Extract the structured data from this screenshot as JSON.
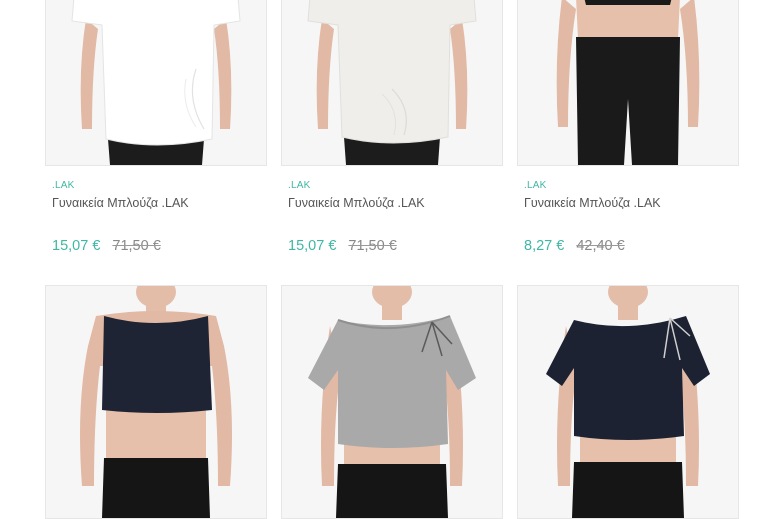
{
  "products": [
    {
      "brand": ".LAK",
      "title": "Γυναικεία Μπλούζα .LAK",
      "price_new": "15,07 €",
      "price_old": "71,50 €",
      "image": "white-draped-tshirt",
      "top_color": "#f4f4f4",
      "bottom_color": "#1c1c1c"
    },
    {
      "brand": ".LAK",
      "title": "Γυναικεία Μπλούζα .LAK",
      "price_new": "15,07 €",
      "price_old": "71,50 €",
      "image": "offwhite-draped-tshirt",
      "top_color": "#efeeea",
      "bottom_color": "#1c1c1c"
    },
    {
      "brand": ".LAK",
      "title": "Γυναικεία Μπλούζα .LAK",
      "price_new": "8,27 €",
      "price_old": "42,40 €",
      "image": "black-crop-top",
      "top_color": "#1a1a1a",
      "bottom_color": "#1a1a1a"
    },
    {
      "image": "navy-sleeveless-crop-top",
      "top_color": "#1e2433",
      "bottom_color": "#151515"
    },
    {
      "image": "grey-crop-tshirt-with-tie",
      "top_color": "#a9a9a9",
      "bottom_color": "#151515"
    },
    {
      "image": "navy-crop-tshirt-with-tie",
      "top_color": "#1d2232",
      "bottom_color": "#151515"
    }
  ]
}
